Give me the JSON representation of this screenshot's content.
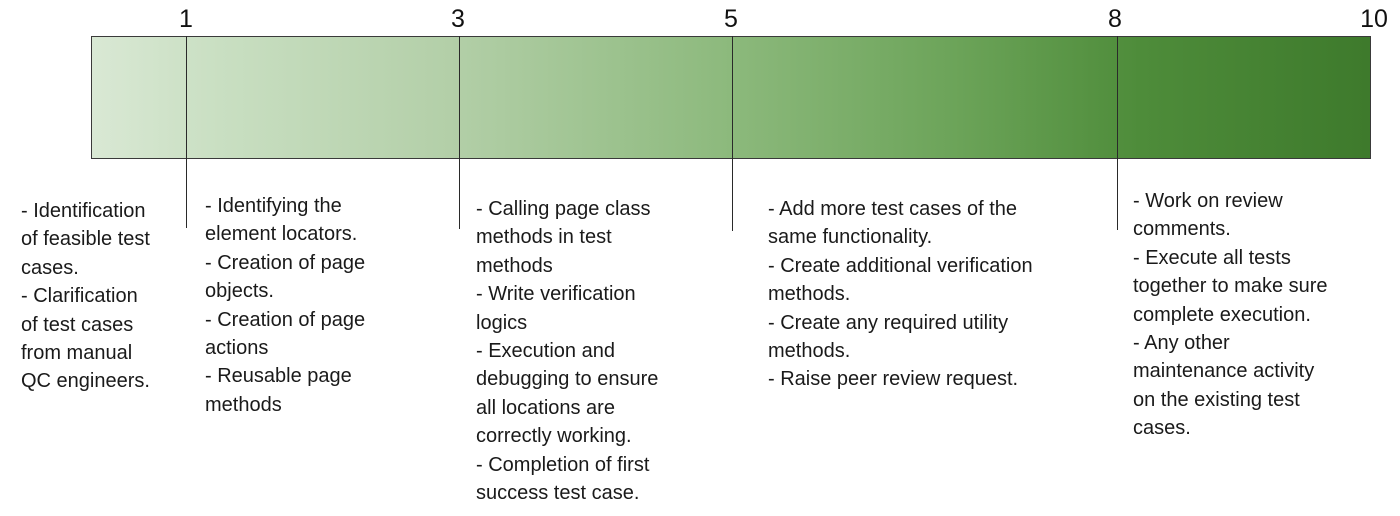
{
  "scale": {
    "gradient_start": "#d9e8d4",
    "gradient_end": "#3e7a2c",
    "ticks": [
      "1",
      "3",
      "5",
      "8",
      "10"
    ]
  },
  "notes": [
    [
      "- Identification",
      "of feasible test",
      "cases.",
      "- Clarification",
      "of test cases",
      "from manual",
      "QC engineers."
    ],
    [
      "- Identifying the",
      "element locators.",
      "- Creation of page",
      "objects.",
      "- Creation of page",
      "actions",
      "- Reusable page",
      "methods"
    ],
    [
      "- Calling page class",
      "methods in test",
      "methods",
      "- Write verification",
      "logics",
      "- Execution and",
      "debugging to ensure",
      "all locations are",
      "correctly working.",
      "- Completion of first",
      "success test case."
    ],
    [
      "- Add more test cases of the",
      "same functionality.",
      "- Create additional verification",
      "methods.",
      "- Create any required utility",
      "methods.",
      "- Raise peer review request."
    ],
    [
      "- Work on review",
      "comments.",
      "-  Execute all tests",
      "together to make sure",
      "complete execution.",
      "- Any other",
      "maintenance activity",
      "on the existing test",
      "cases."
    ]
  ]
}
